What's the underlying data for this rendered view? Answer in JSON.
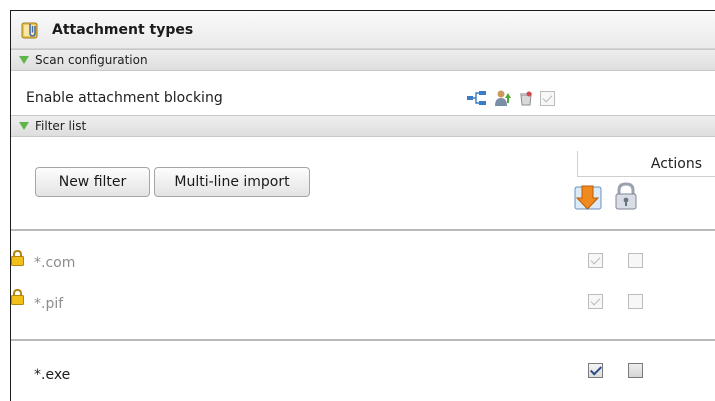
{
  "panel": {
    "title": "Attachment types",
    "icon": "attachment-types-icon"
  },
  "scan_configuration": {
    "header": "Scan configuration",
    "enable_label": "Enable attachment blocking",
    "enable_checked": true,
    "enable_disabled": true,
    "icons": [
      "hierarchy-icon",
      "inherit-user-icon",
      "cleanup-icon"
    ]
  },
  "filter_list": {
    "header": "Filter list",
    "new_filter_label": "New filter",
    "multiline_import_label": "Multi-line import",
    "actions_header": "Actions",
    "action_icons": [
      "block-action-icon",
      "lock-action-icon"
    ],
    "builtin_filters": [
      {
        "name": "*.com",
        "locked": true,
        "action1": true,
        "action2": false
      },
      {
        "name": "*.pif",
        "locked": true,
        "action1": true,
        "action2": false
      }
    ],
    "user_filters": [
      {
        "name": "*.exe",
        "locked": false,
        "action1": true,
        "action2": false
      }
    ]
  },
  "colors": {
    "section_triangle": "#5fb648",
    "checkbox_check": "#2b4a86",
    "disabled_text": "#8d8d8d"
  }
}
